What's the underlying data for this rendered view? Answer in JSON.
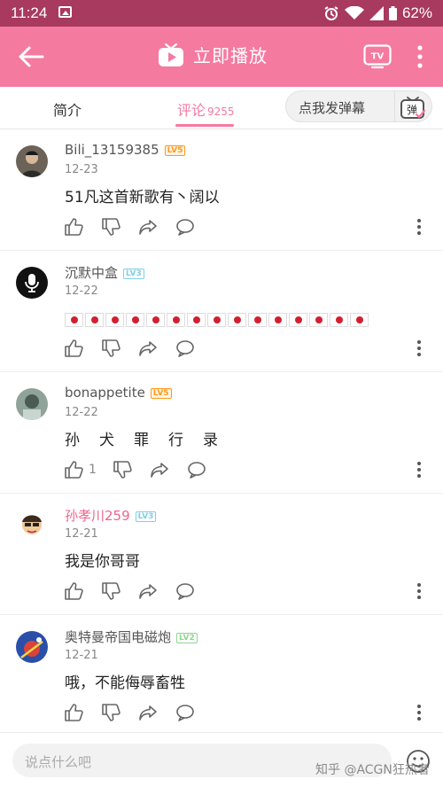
{
  "status": {
    "time": "11:24",
    "battery": "62%"
  },
  "appbar": {
    "title": "立即播放",
    "tv_label": "TV"
  },
  "tabs": {
    "intro": "简介",
    "comments": "评论",
    "comment_count": "9255",
    "danmaku_button": "点我发弹幕",
    "danmaku_icon_label": "弹"
  },
  "comments": [
    {
      "user": "Bili_13159385",
      "level": "LV5",
      "date": "12-23",
      "text": "51凡这首新歌有丶阔以"
    },
    {
      "user": "沉默中盒",
      "level": "LV3",
      "date": "12-22",
      "flag_count": 15
    },
    {
      "user": "bonappetite",
      "level": "LV5",
      "date": "12-22",
      "text": "孙犬罪行录",
      "likes": "1"
    },
    {
      "user": "孙孝川259",
      "level": "LV3",
      "date": "12-21",
      "text": "我是你哥哥"
    },
    {
      "user": "奥特曼帝国电磁炮",
      "level": "LV2",
      "date": "12-21",
      "text": "哦，不能侮辱畜牲"
    }
  ],
  "bottombar": {
    "placeholder": "说点什么吧"
  },
  "watermark": "知乎 @ACGN狂热者",
  "colors": {
    "accent": "#f57aa0",
    "statusbar": "#a8395f"
  }
}
